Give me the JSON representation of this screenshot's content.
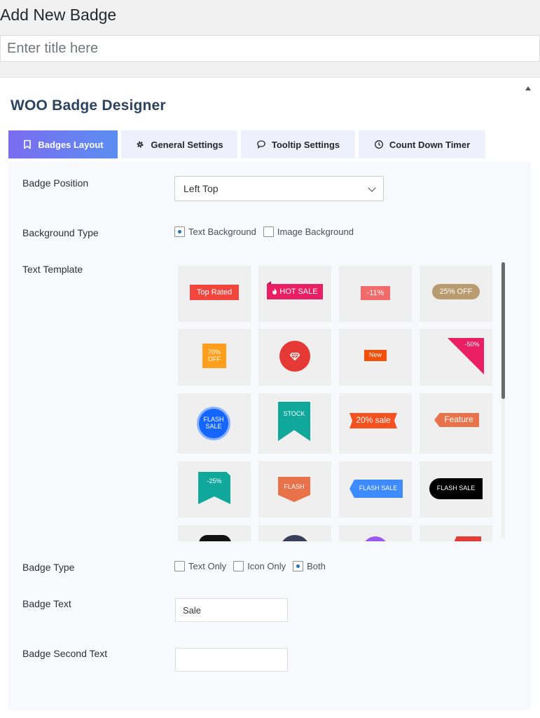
{
  "page": {
    "title": "Add New Badge",
    "title_placeholder": "Enter title here"
  },
  "plugin": {
    "title": "WOO Badge Designer"
  },
  "tabs": [
    {
      "label": "Badges Layout",
      "icon": "bookmark-icon",
      "active": true
    },
    {
      "label": "General Settings",
      "icon": "gear-icon",
      "active": false
    },
    {
      "label": "Tooltip Settings",
      "icon": "speech-bubble-icon",
      "active": false
    },
    {
      "label": "Count Down Timer",
      "icon": "clock-icon",
      "active": false
    }
  ],
  "form": {
    "badge_position": {
      "label": "Badge Position",
      "value": "Left Top"
    },
    "background_type": {
      "label": "Background Type",
      "options": [
        {
          "label": "Text Background",
          "checked": true
        },
        {
          "label": "Image Background",
          "checked": false
        }
      ]
    },
    "text_template": {
      "label": "Text Template",
      "badges": [
        {
          "text": "Top Rated",
          "color": "#f2453d"
        },
        {
          "text": "HOT SALE",
          "color": "#e91e63"
        },
        {
          "text": "-11%",
          "color": "#f26b6b"
        },
        {
          "text": "25% OFF",
          "color": "#b89b6e"
        },
        {
          "text": "70% OFF",
          "color": "#ff9f1c"
        },
        {
          "text": "",
          "color": "#e53935"
        },
        {
          "text": "New",
          "color": "#f44e0b"
        },
        {
          "text": "-50%",
          "color": "#e91e63"
        },
        {
          "text": "FLASH SALE",
          "color": "#1565ff"
        },
        {
          "text": "STOCK",
          "color": "#0fa89b"
        },
        {
          "text": "20% sale",
          "color": "#f4511e"
        },
        {
          "text": "Feature",
          "color": "#e8724a"
        },
        {
          "text": "-25%",
          "color": "#0fa89b"
        },
        {
          "text": "FLASH",
          "color": "#e8724a"
        },
        {
          "text": "FLASH SALE",
          "color": "#3d8bff"
        },
        {
          "text": "FLASH SALE",
          "color": "#000000"
        },
        {
          "text": "",
          "color": "#111111"
        },
        {
          "text": "",
          "color": "#3a3f5c"
        },
        {
          "text": "",
          "color": "#9b59f0"
        },
        {
          "text": "",
          "color": "#e53935"
        }
      ]
    },
    "badge_type": {
      "label": "Badge Type",
      "options": [
        {
          "label": "Text Only",
          "checked": false
        },
        {
          "label": "Icon Only",
          "checked": false
        },
        {
          "label": "Both",
          "checked": true
        }
      ]
    },
    "badge_text": {
      "label": "Badge Text",
      "value": "Sale"
    },
    "badge_second_text": {
      "label": "Badge Second Text",
      "value": ""
    }
  }
}
